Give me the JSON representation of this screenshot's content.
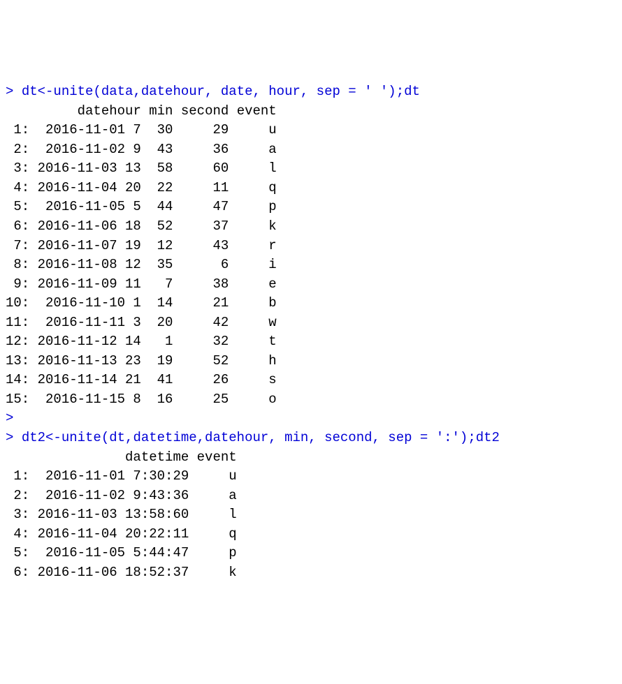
{
  "console": {
    "prompt": ">",
    "cmd1": "dt<-unite(data,datehour, date, hour, sep = ' ');dt",
    "header1": {
      "datehour": "datehour",
      "min": "min",
      "second": "second",
      "event": "event"
    },
    "table1": [
      {
        "n": "1",
        "datehour": "2016-11-01 7",
        "min": "30",
        "second": "29",
        "event": "u"
      },
      {
        "n": "2",
        "datehour": "2016-11-02 9",
        "min": "43",
        "second": "36",
        "event": "a"
      },
      {
        "n": "3",
        "datehour": "2016-11-03 13",
        "min": "58",
        "second": "60",
        "event": "l"
      },
      {
        "n": "4",
        "datehour": "2016-11-04 20",
        "min": "22",
        "second": "11",
        "event": "q"
      },
      {
        "n": "5",
        "datehour": "2016-11-05 5",
        "min": "44",
        "second": "47",
        "event": "p"
      },
      {
        "n": "6",
        "datehour": "2016-11-06 18",
        "min": "52",
        "second": "37",
        "event": "k"
      },
      {
        "n": "7",
        "datehour": "2016-11-07 19",
        "min": "12",
        "second": "43",
        "event": "r"
      },
      {
        "n": "8",
        "datehour": "2016-11-08 12",
        "min": "35",
        "second": " 6",
        "event": "i"
      },
      {
        "n": "9",
        "datehour": "2016-11-09 11",
        "min": " 7",
        "second": "38",
        "event": "e"
      },
      {
        "n": "10",
        "datehour": "2016-11-10 1",
        "min": "14",
        "second": "21",
        "event": "b"
      },
      {
        "n": "11",
        "datehour": "2016-11-11 3",
        "min": "20",
        "second": "42",
        "event": "w"
      },
      {
        "n": "12",
        "datehour": "2016-11-12 14",
        "min": " 1",
        "second": "32",
        "event": "t"
      },
      {
        "n": "13",
        "datehour": "2016-11-13 23",
        "min": "19",
        "second": "52",
        "event": "h"
      },
      {
        "n": "14",
        "datehour": "2016-11-14 21",
        "min": "41",
        "second": "26",
        "event": "s"
      },
      {
        "n": "15",
        "datehour": "2016-11-15 8",
        "min": "16",
        "second": "25",
        "event": "o"
      }
    ],
    "cmd2": "dt2<-unite(dt,datetime,datehour, min, second, sep = ':');dt2",
    "header2": {
      "datetime": "datetime",
      "event": "event"
    },
    "table2": [
      {
        "n": "1",
        "datetime": "2016-11-01 7:30:29",
        "event": "u"
      },
      {
        "n": "2",
        "datetime": "2016-11-02 9:43:36",
        "event": "a"
      },
      {
        "n": "3",
        "datetime": "2016-11-03 13:58:60",
        "event": "l"
      },
      {
        "n": "4",
        "datetime": "2016-11-04 20:22:11",
        "event": "q"
      },
      {
        "n": "5",
        "datetime": "2016-11-05 5:44:47",
        "event": "p"
      },
      {
        "n": "6",
        "datetime": "2016-11-06 18:52:37",
        "event": "k"
      }
    ]
  }
}
